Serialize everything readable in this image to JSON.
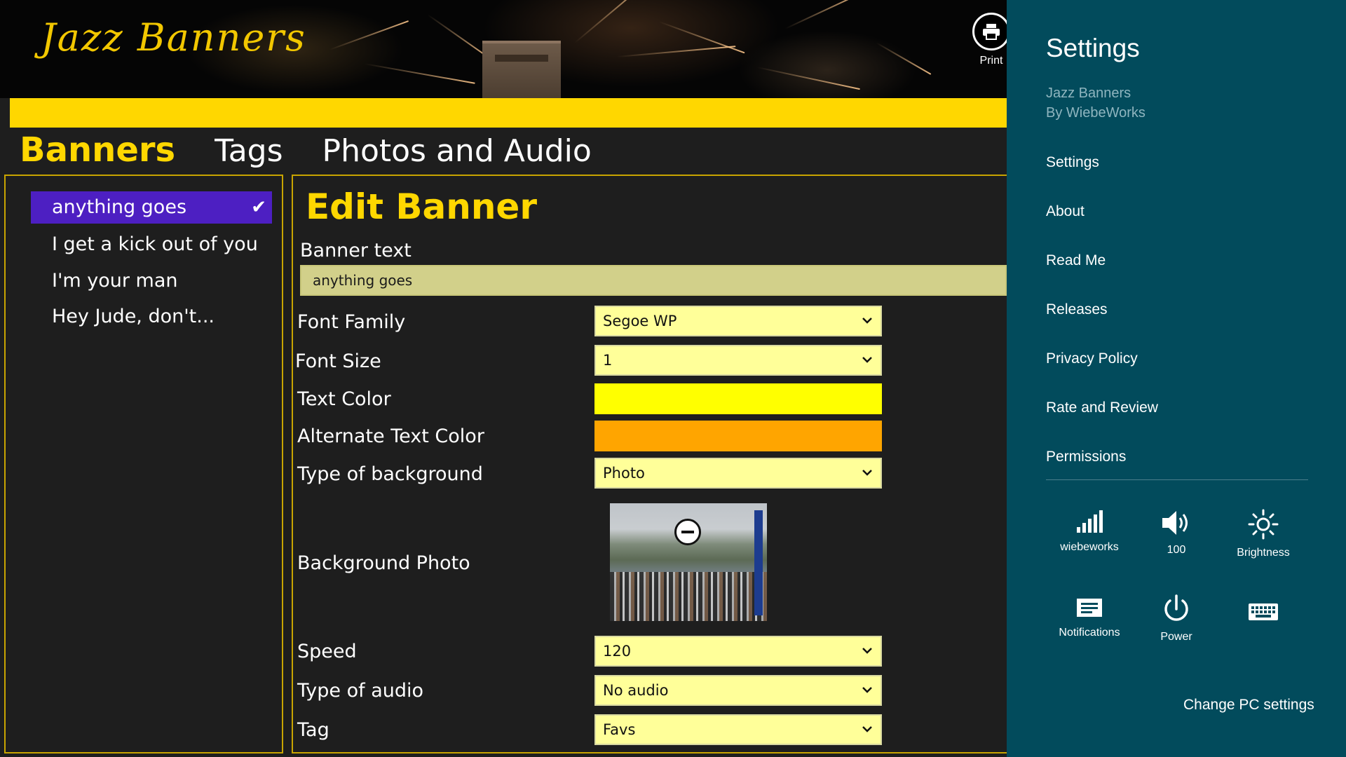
{
  "app": {
    "logo": "Jazz Banners",
    "print_label": "Print"
  },
  "tabs": [
    {
      "label": "Banners",
      "active": true
    },
    {
      "label": "Tags",
      "active": false
    },
    {
      "label": "Photos and Audio",
      "active": false
    }
  ],
  "banners": [
    {
      "label": "anything goes",
      "selected": true
    },
    {
      "label": "I get a kick out of you",
      "selected": false
    },
    {
      "label": "I'm your man",
      "selected": false
    },
    {
      "label": "Hey Jude, don't...",
      "selected": false
    }
  ],
  "editor": {
    "title": "Edit Banner",
    "banner_text_label": "Banner text",
    "banner_text_value": "anything goes",
    "font_family_label": "Font Family",
    "font_family_value": "Segoe WP",
    "font_size_label": "Font Size",
    "font_size_value": "1",
    "text_color_label": "Text Color",
    "text_color": "#ffff00",
    "alt_text_color_label": "Alternate Text Color",
    "alt_text_color": "#ffa500",
    "background_type_label": "Type of background",
    "background_type_value": "Photo",
    "background_photo_label": "Background Photo",
    "speed_label": "Speed",
    "speed_value": "120",
    "audio_type_label": "Type of audio",
    "audio_type_value": "No audio",
    "tag_label": "Tag",
    "tag_value": "Favs"
  },
  "settings_charm": {
    "title": "Settings",
    "app_name": "Jazz Banners",
    "publisher": "By WiebeWorks",
    "links": [
      "Settings",
      "About",
      "Read Me",
      "Releases",
      "Privacy Policy",
      "Rate and Review",
      "Permissions"
    ],
    "quick": {
      "network": "wiebeworks",
      "volume": "100",
      "brightness": "Brightness",
      "notifications": "Notifications",
      "power": "Power"
    },
    "change_pc_settings": "Change PC settings"
  },
  "colors": {
    "accent": "#ffd700",
    "selection": "#4d1fc2",
    "charm_bg": "#024b5c"
  }
}
